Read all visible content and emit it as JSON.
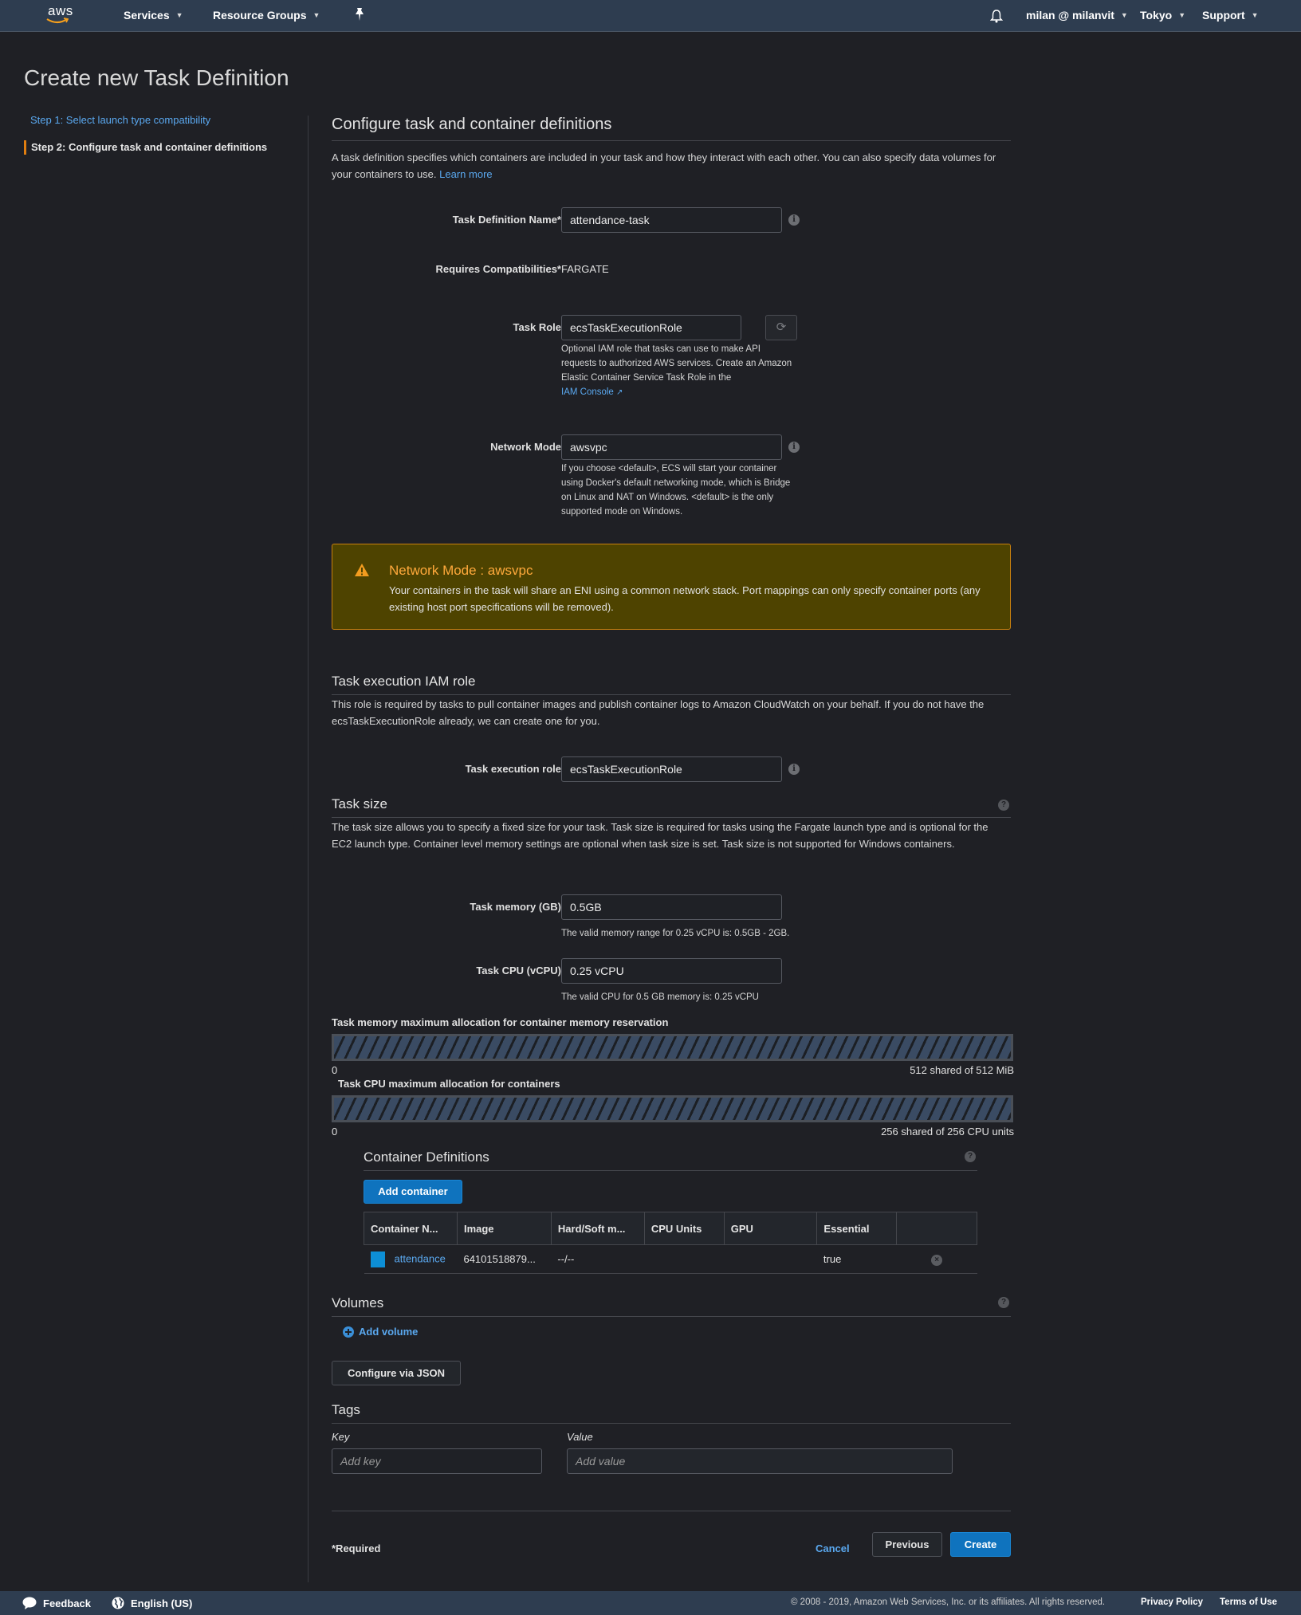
{
  "topnav": {
    "logo_text": "aws",
    "services": "Services",
    "resource_groups": "Resource Groups",
    "user": "milan @ milanvit",
    "region": "Tokyo",
    "support": "Support"
  },
  "page_title": "Create new Task Definition",
  "steps": [
    {
      "label": "Step 1: Select launch type compatibility",
      "state": "link"
    },
    {
      "label": "Step 2: Configure task and container definitions",
      "state": "current"
    }
  ],
  "main": {
    "title": "Configure task and container definitions",
    "intro": "A task definition specifies which containers are included in your task and how they interact with each other. You can also specify data volumes for your containers to use.",
    "learn_more": "Learn more",
    "task_definition_name": {
      "label": "Task Definition Name*",
      "value": "attendance-task"
    },
    "requires_compatibilities": {
      "label": "Requires Compatibilities*",
      "value": "FARGATE"
    },
    "task_role": {
      "label": "Task Role",
      "value": "ecsTaskExecutionRole",
      "help": "Optional IAM role that tasks can use to make API requests to authorized AWS services. Create an Amazon Elastic Container Service Task Role in the",
      "help_link": "IAM Console"
    },
    "network_mode": {
      "label": "Network Mode",
      "value": "awsvpc",
      "help": "If you choose <default>, ECS will start your container using Docker's default networking mode, which is Bridge on Linux and NAT on Windows. <default> is the only supported mode on Windows."
    },
    "alert": {
      "title": "Network Mode : awsvpc",
      "body": "Your containers in the task will share an ENI using a common network stack. Port mappings can only specify container ports (any existing host port specifications will be removed).",
      "color": "#ffa93b"
    },
    "execution_role_section": {
      "title": "Task execution IAM role",
      "desc": "This role is required by tasks to pull container images and publish container logs to Amazon CloudWatch on your behalf. If you do not have the ecsTaskExecutionRole already, we can create one for you.",
      "label": "Task execution role",
      "value": "ecsTaskExecutionRole"
    },
    "task_size": {
      "title": "Task size",
      "desc": "The task size allows you to specify a fixed size for your task. Task size is required for tasks using the Fargate launch type and is optional for the EC2 launch type. Container level memory settings are optional when task size is set. Task size is not supported for Windows containers.",
      "memory_label": "Task memory (GB)",
      "memory_value": "0.5GB",
      "memory_help": "The valid memory range for 0.25 vCPU is: 0.5GB - 2GB.",
      "cpu_label": "Task CPU (vCPU)",
      "cpu_value": "0.25 vCPU",
      "cpu_help": "The valid CPU for 0.5 GB memory is: 0.25 vCPU"
    },
    "memory_allocation": {
      "label": "Task memory maximum allocation for container memory reservation",
      "min": "0",
      "max_text": "512 shared of 512 MiB",
      "shared": 512,
      "total": 512
    },
    "cpu_allocation": {
      "label": "Task CPU maximum allocation for containers",
      "min": "0",
      "max_text": "256 shared of 256 CPU units",
      "shared": 256,
      "total": 256
    },
    "container_definitions": {
      "title": "Container Definitions",
      "add_button": "Add container",
      "columns": [
        "Container N...",
        "Image",
        "Hard/Soft m...",
        "CPU Units",
        "GPU",
        "Essential",
        ""
      ],
      "rows": [
        {
          "name": "attendance",
          "image": "64101518879...",
          "memory": "--/--",
          "cpu": "",
          "gpu": "",
          "essential": "true",
          "color": "#0d8fd6"
        }
      ]
    },
    "volumes": {
      "title": "Volumes",
      "add_volume": "Add volume",
      "configure_json": "Configure via JSON"
    },
    "tags": {
      "title": "Tags",
      "key_label": "Key",
      "value_label": "Value",
      "key_placeholder": "Add key",
      "value_placeholder": "Add value"
    },
    "required_note": "*Required",
    "cancel": "Cancel",
    "previous": "Previous",
    "create": "Create"
  },
  "footer": {
    "feedback": "Feedback",
    "language": "English (US)",
    "copyright": "© 2008 - 2019, Amazon Web Services, Inc. or its affiliates. All rights reserved.",
    "privacy": "Privacy Policy",
    "terms": "Terms of Use"
  }
}
